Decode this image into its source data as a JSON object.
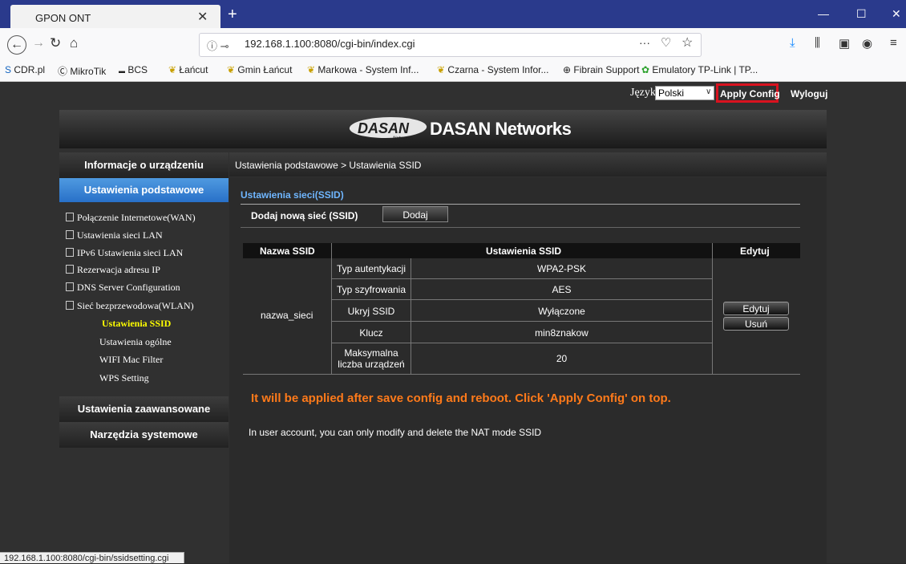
{
  "browser": {
    "tab_title": "GPON ONT",
    "tab_close": "✕",
    "new_tab": "+",
    "window_controls": {
      "minimize": "—",
      "maximize": "☐",
      "close": "✕"
    },
    "url": "192.168.1.100:8080/cgi-bin/index.cgi",
    "url_more": "···",
    "bookmarks": [
      "CDR.pl",
      "MikroTik",
      "BCS",
      "Łańcut",
      "Gmin Łańcut",
      "Markowa - System Inf...",
      "Czarna - System Infor...",
      "Fibrain Support",
      "Emulatory TP-Link | TP..."
    ],
    "status_url": "192.168.1.100:8080/cgi-bin/ssidsetting.cgi"
  },
  "topbar": {
    "language_label": "Język",
    "language_value": "Polski",
    "apply_config": "Apply Config",
    "logout": "Wyloguj"
  },
  "header": {
    "logo": "DASAN",
    "logo_sub": "Networks",
    "title": "DASAN Networks"
  },
  "sidebar": {
    "device_info": "Informacje o urządzeniu",
    "basic_settings": "Ustawienia podstawowe",
    "items": [
      "Połączenie Internetowe(WAN)",
      "Ustawienia sieci LAN",
      "IPv6 Ustawienia sieci LAN",
      "Rezerwacja adresu IP",
      "DNS Server Configuration",
      "Sieć bezprzewodowa(WLAN)"
    ],
    "sub_items": [
      "Ustawienia SSID",
      "Ustawienia ogólne",
      "WIFI Mac Filter",
      "WPS Setting"
    ],
    "advanced": "Ustawienia zaawansowane",
    "tools": "Narzędzia systemowe"
  },
  "content": {
    "breadcrumb": "Ustawienia podstawowe > Ustawienia SSID",
    "section_title": "Ustawienia sieci(SSID)",
    "add_label": "Dodaj nową sieć (SSID)",
    "add_button": "Dodaj",
    "table": {
      "headers": {
        "name": "Nazwa SSID",
        "settings": "Ustawienia SSID",
        "edit": "Edytuj"
      },
      "ssid_name": "nazwa_sieci",
      "rows": [
        {
          "label": "Typ autentykacji",
          "value": "WPA2-PSK"
        },
        {
          "label": "Typ szyfrowania",
          "value": "AES"
        },
        {
          "label": "Ukryj SSID",
          "value": "Wyłączone"
        },
        {
          "label": "Klucz",
          "value": "min8znakow"
        },
        {
          "label": "Maksymalna liczba urządzeń",
          "value": "20"
        }
      ],
      "edit_button": "Edytuj",
      "delete_button": "Usuń"
    },
    "notice": "It will be applied after save config and reboot. Click 'Apply Config' on top.",
    "info": "In user account, you can only modify and delete the NAT mode SSID"
  }
}
